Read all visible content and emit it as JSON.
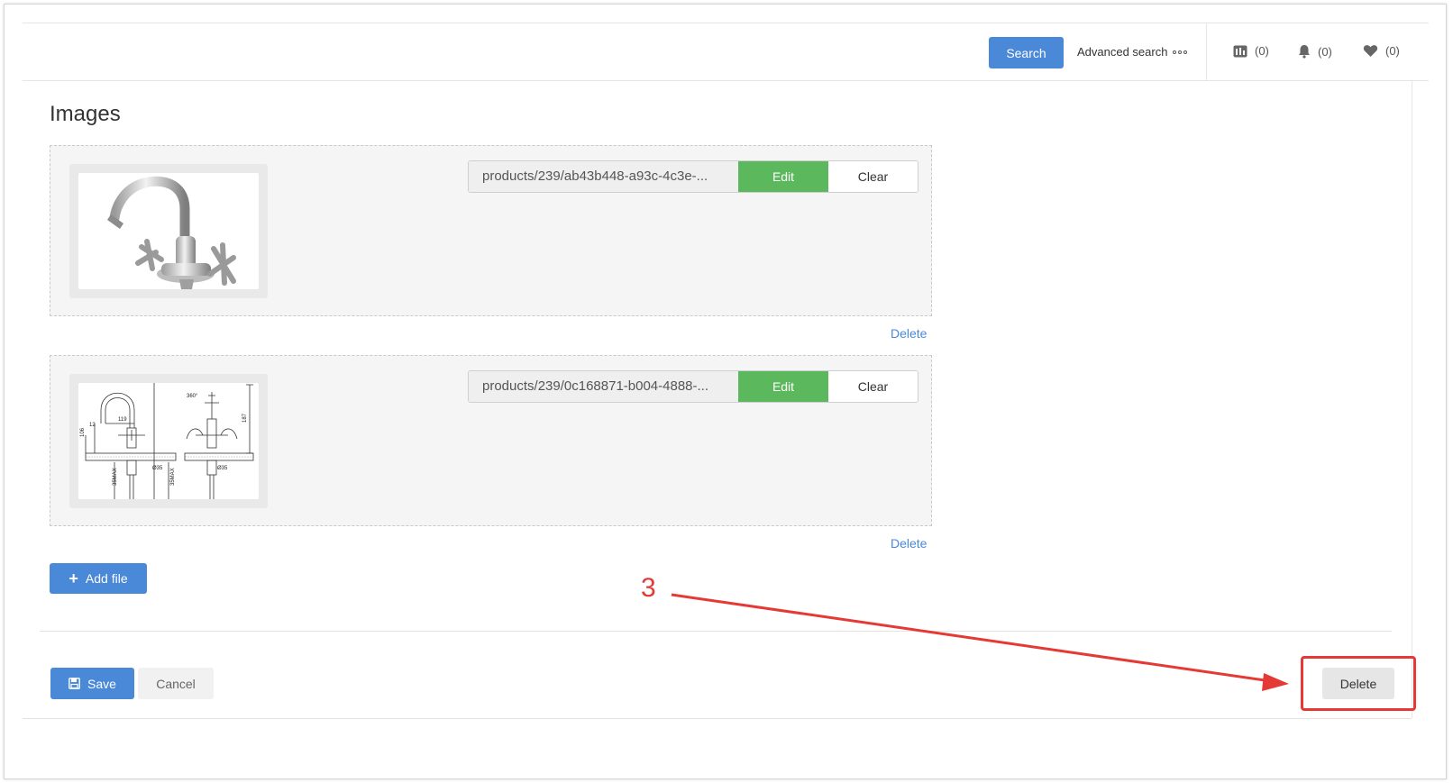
{
  "header": {
    "search_label": "Search",
    "advanced_search_label": "Advanced search",
    "compare_count": "(0)",
    "notifications_count": "(0)",
    "favorites_count": "(0)"
  },
  "section": {
    "title": "Images"
  },
  "images": [
    {
      "path": "products/239/ab43b448-a93c-4c3e-...",
      "edit_label": "Edit",
      "clear_label": "Clear",
      "delete_label": "Delete"
    },
    {
      "path": "products/239/0c168871-b004-4888-...",
      "edit_label": "Edit",
      "clear_label": "Clear",
      "delete_label": "Delete"
    }
  ],
  "drawing_labels": {
    "d1": "119",
    "d2": "106",
    "d3": "360°",
    "d4": "187",
    "d5": "Ø35",
    "d6": "Ø35",
    "d7": "35MAX",
    "d8": "35MAX",
    "d9": "12"
  },
  "actions": {
    "add_file_label": "Add file",
    "save_label": "Save",
    "cancel_label": "Cancel",
    "delete_label": "Delete"
  },
  "annotation": {
    "number": "3",
    "color": "#e53935"
  },
  "colors": {
    "primary": "#4a88d8",
    "success": "#5cb85c",
    "annotation": "#e53935"
  }
}
